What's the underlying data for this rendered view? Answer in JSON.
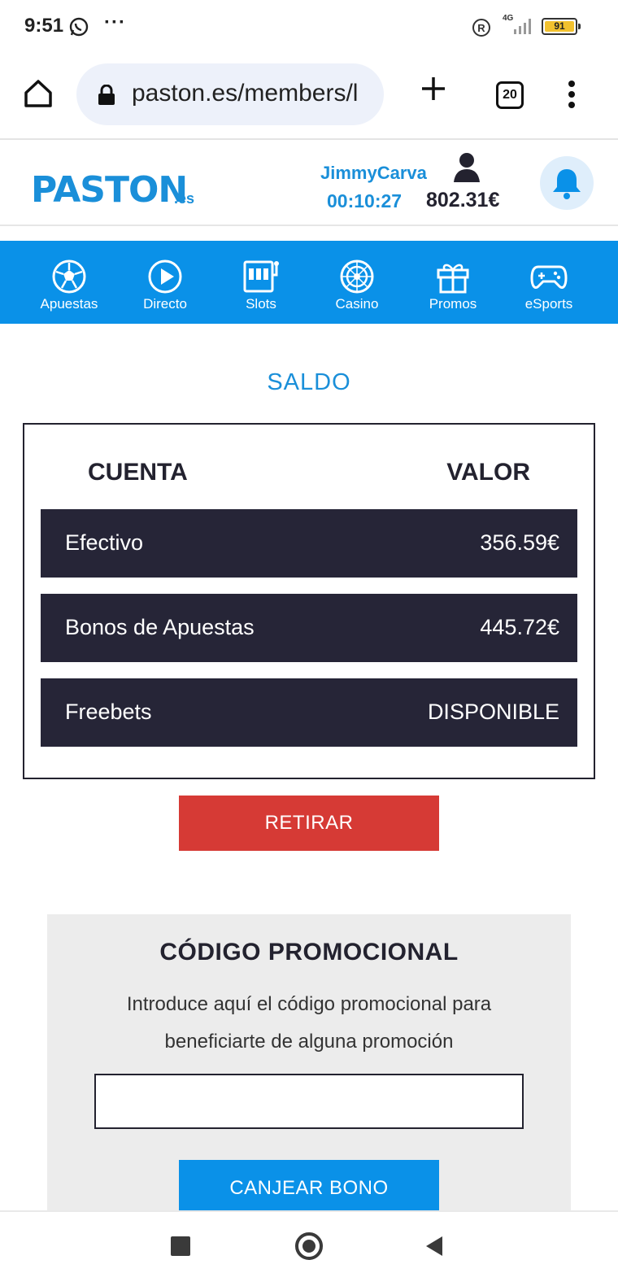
{
  "status_bar": {
    "time": "9:51",
    "more": "···",
    "network": "4G",
    "battery": "91"
  },
  "browser": {
    "url": "paston.es/members/l",
    "tab_count": "20"
  },
  "header": {
    "logo_text": "PASTON",
    "logo_tld": ".es",
    "username": "JimmyCarva",
    "session_timer": "00:10:27",
    "balance": "802.31€"
  },
  "nav": {
    "items": [
      {
        "label": "Apuestas",
        "icon": "soccer-ball-icon"
      },
      {
        "label": "Directo",
        "icon": "play-icon"
      },
      {
        "label": "Slots",
        "icon": "slot-machine-icon"
      },
      {
        "label": "Casino",
        "icon": "roulette-icon"
      },
      {
        "label": "Promos",
        "icon": "gift-icon"
      },
      {
        "label": "eSports",
        "icon": "gamepad-icon"
      }
    ]
  },
  "saldo": {
    "title": "SALDO",
    "col_account": "CUENTA",
    "col_value": "VALOR",
    "rows": [
      {
        "label": "Efectivo",
        "value": "356.59€"
      },
      {
        "label": "Bonos de Apuestas",
        "value": "445.72€"
      },
      {
        "label": "Freebets",
        "value": "DISPONIBLE"
      }
    ],
    "withdraw_label": "RETIRAR"
  },
  "promo": {
    "title": "CÓDIGO PROMOCIONAL",
    "description": "Introduce aquí el código promocional para beneficiarte de alguna promoción",
    "input_value": "",
    "redeem_label": "CANJEAR BONO"
  },
  "colors": {
    "brand_blue": "#0a91e8",
    "dark_row": "#262537",
    "withdraw_red": "#d63a35"
  }
}
